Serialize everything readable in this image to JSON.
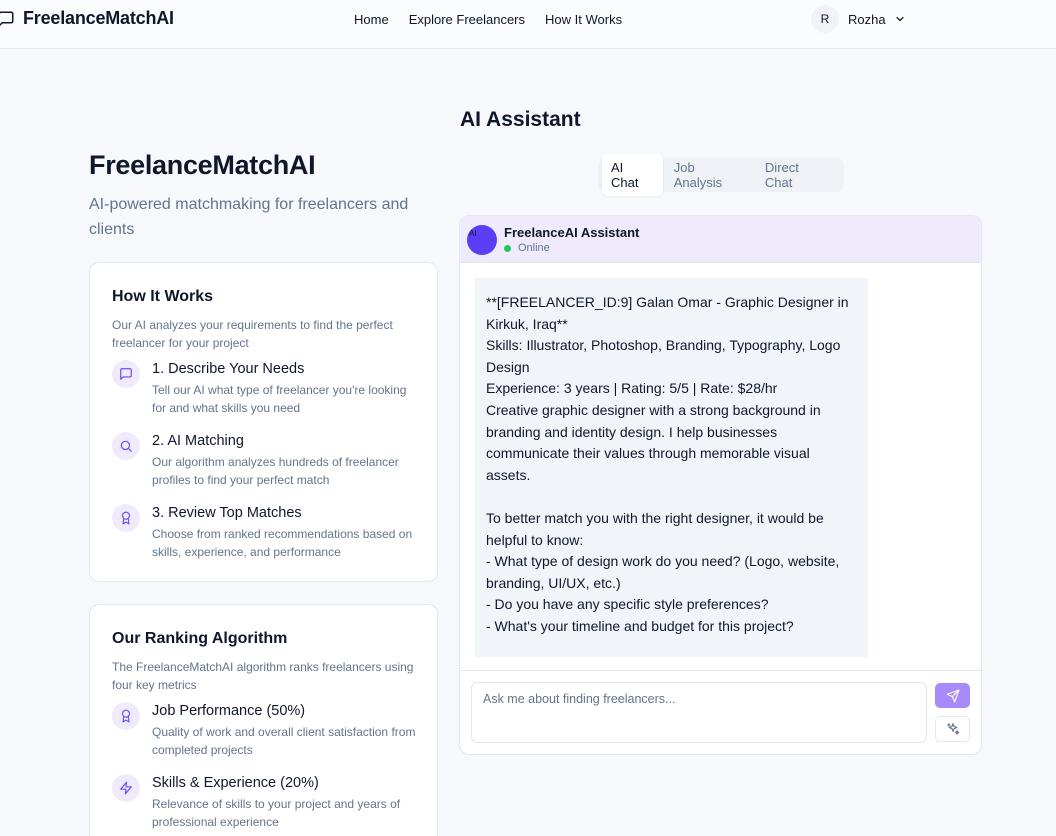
{
  "header": {
    "brand": "FreelanceMatchAI",
    "nav": [
      "Home",
      "Explore Freelancers",
      "How It Works"
    ],
    "user_initial": "R",
    "user_name": "Rozha"
  },
  "left": {
    "title": "FreelanceMatchAI",
    "subtitle": "AI-powered matchmaking for freelancers and clients",
    "how_it_works": {
      "title": "How It Works",
      "description": "Our AI analyzes your requirements to find the perfect freelancer for your project",
      "steps": [
        {
          "icon": "message-square-icon",
          "title": "1. Describe Your Needs",
          "desc": "Tell our AI what type of freelancer you're looking for and what skills you need"
        },
        {
          "icon": "search-icon",
          "title": "2. AI Matching",
          "desc": "Our algorithm analyzes hundreds of freelancer profiles to find your perfect match"
        },
        {
          "icon": "award-icon",
          "title": "3. Review Top Matches",
          "desc": "Choose from ranked recommendations based on skills, experience, and performance"
        }
      ]
    },
    "ranking": {
      "title": "Our Ranking Algorithm",
      "description": "The FreelanceMatchAI algorithm ranks freelancers using four key metrics",
      "metrics": [
        {
          "icon": "award-icon",
          "title": "Job Performance (50%)",
          "desc": "Quality of work and overall client satisfaction from completed projects"
        },
        {
          "icon": "zap-icon",
          "title": "Skills & Experience (20%)",
          "desc": "Relevance of skills to your project and years of professional experience"
        }
      ]
    }
  },
  "assistant": {
    "title": "AI Assistant",
    "tabs": [
      "AI Chat",
      "Job Analysis",
      "Direct Chat"
    ],
    "active_tab": "AI Chat",
    "bot_avatar_text": "AI",
    "bot_name": "FreelanceAI Assistant",
    "status": "Online",
    "message_lines": [
      "**[FREELANCER_ID:9] Galan Omar - Graphic Designer in",
      "Kirkuk, Iraq**",
      "Skills: Illustrator, Photoshop, Branding, Typography, Logo",
      "Design",
      "Experience: 3 years | Rating: 5/5 | Rate: $28/hr",
      "Creative graphic designer with a strong background in",
      "branding and identity design. I help businesses",
      "communicate their values through memorable visual",
      "assets.",
      "",
      "To better match you with the right designer, it would be",
      "helpful to know:",
      "- What type of design work do you need? (Logo, website,",
      "branding, UI/UX, etc.)",
      "- Do you have any specific style preferences?",
      "- What's your timeline and budget for this project?"
    ],
    "input_placeholder": "Ask me about finding freelancers...",
    "colors": {
      "accent": "#a78bfa",
      "avatar": "#5b3df5",
      "header_bg": "#efebfd",
      "online": "#22c55e"
    }
  }
}
